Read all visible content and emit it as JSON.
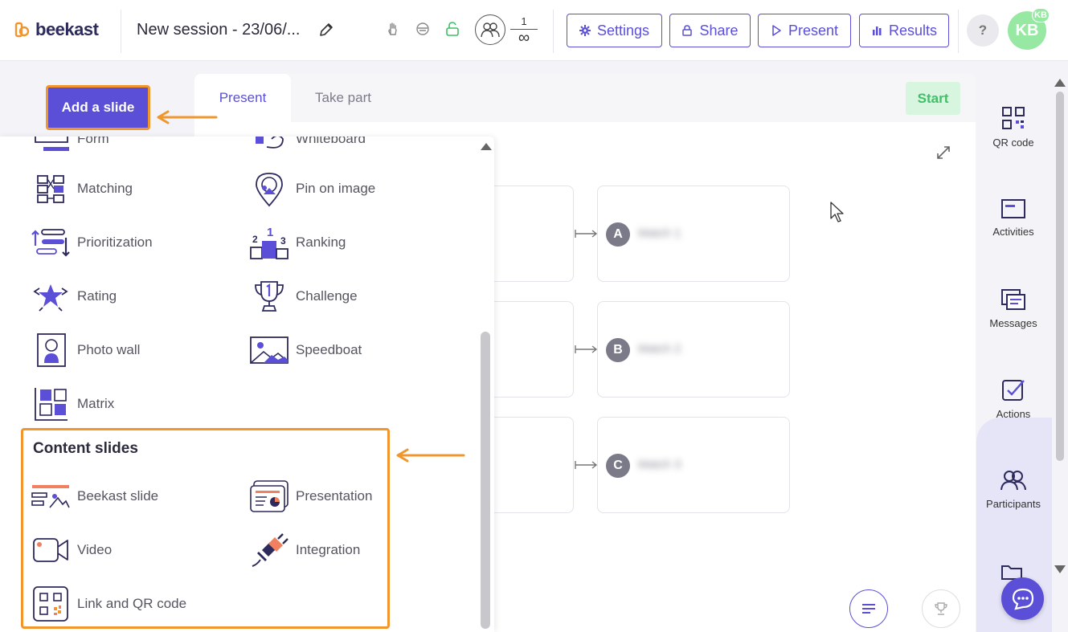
{
  "app": {
    "logo_text": "beekast",
    "session_title": "New session - 23/06/...",
    "participants_current": "1",
    "participants_max": "∞"
  },
  "header_buttons": {
    "settings": "Settings",
    "share": "Share",
    "present": "Present",
    "results": "Results",
    "help": "?",
    "avatar_initials": "KB",
    "avatar_badge": "KB"
  },
  "add_slide_label": "Add a slide",
  "tabs": {
    "present": "Present",
    "take_part": "Take part",
    "start": "Start"
  },
  "match_rows": [
    {
      "letter": "A",
      "text": "Match 1"
    },
    {
      "letter": "B",
      "text": "Match 2"
    },
    {
      "letter": "C",
      "text": "Match 3"
    }
  ],
  "slide_types": {
    "form": "Form",
    "whiteboard": "Whiteboard",
    "matching": "Matching",
    "pin_on_image": "Pin on image",
    "prioritization": "Prioritization",
    "ranking": "Ranking",
    "rating": "Rating",
    "challenge": "Challenge",
    "photo_wall": "Photo wall",
    "speedboat": "Speedboat",
    "matrix": "Matrix"
  },
  "ranking_icon_digits": {
    "first": "1",
    "second": "2",
    "third": "3"
  },
  "content_slides": {
    "title": "Content slides",
    "beekast_slide": "Beekast slide",
    "presentation": "Presentation",
    "video": "Video",
    "integration": "Integration",
    "link_qr": "Link and QR code"
  },
  "right_sidebar": {
    "qr_code": "QR code",
    "activities": "Activities",
    "messages": "Messages",
    "actions": "Actions",
    "participants": "Participants"
  },
  "colors": {
    "accent": "#5a4fd6",
    "highlight": "#f0962c",
    "start_bg": "#d7f5df",
    "start_text": "#3fbf68",
    "avatar": "#96e8a3",
    "coral": "#f08060"
  }
}
